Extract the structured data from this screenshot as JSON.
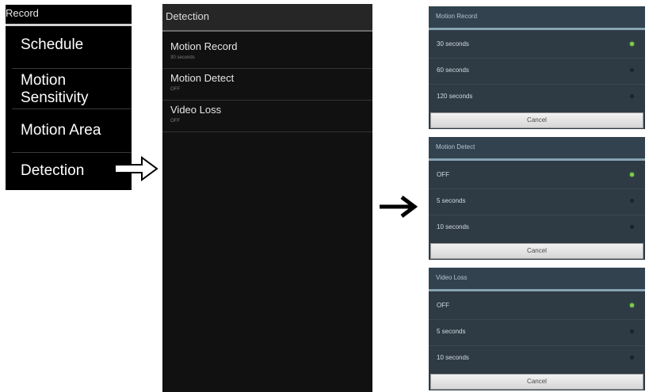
{
  "record_menu": {
    "title": "Record",
    "items": [
      {
        "label_line1": "Schedule",
        "label_line2": ""
      },
      {
        "label_line1": "Motion",
        "label_line2": "Sensitivity"
      },
      {
        "label_line1": "Motion Area",
        "label_line2": ""
      },
      {
        "label_line1": "Detection",
        "label_line2": ""
      }
    ]
  },
  "detection_screen": {
    "title": "Detection",
    "items": [
      {
        "label": "Motion Record",
        "value": "30 seconds"
      },
      {
        "label": "Motion Detect",
        "value": "OFF"
      },
      {
        "label": "Video Loss",
        "value": "OFF"
      }
    ]
  },
  "dialogs": [
    {
      "title": "Motion Record",
      "options": [
        {
          "label": "30 seconds",
          "selected": true
        },
        {
          "label": "60 seconds",
          "selected": false
        },
        {
          "label": "120 seconds",
          "selected": false
        }
      ],
      "cancel_label": "Cancel"
    },
    {
      "title": "Motion Detect",
      "options": [
        {
          "label": "OFF",
          "selected": true
        },
        {
          "label": "5 seconds",
          "selected": false
        },
        {
          "label": "10 seconds",
          "selected": false
        }
      ],
      "cancel_label": "Cancel"
    },
    {
      "title": "Video Loss",
      "options": [
        {
          "label": "OFF",
          "selected": true
        },
        {
          "label": "5 seconds",
          "selected": false
        },
        {
          "label": "10 seconds",
          "selected": false
        }
      ],
      "cancel_label": "Cancel"
    }
  ],
  "colors": {
    "selected_radio": "#7fd24b",
    "dialog_background": "#2e3a44"
  }
}
